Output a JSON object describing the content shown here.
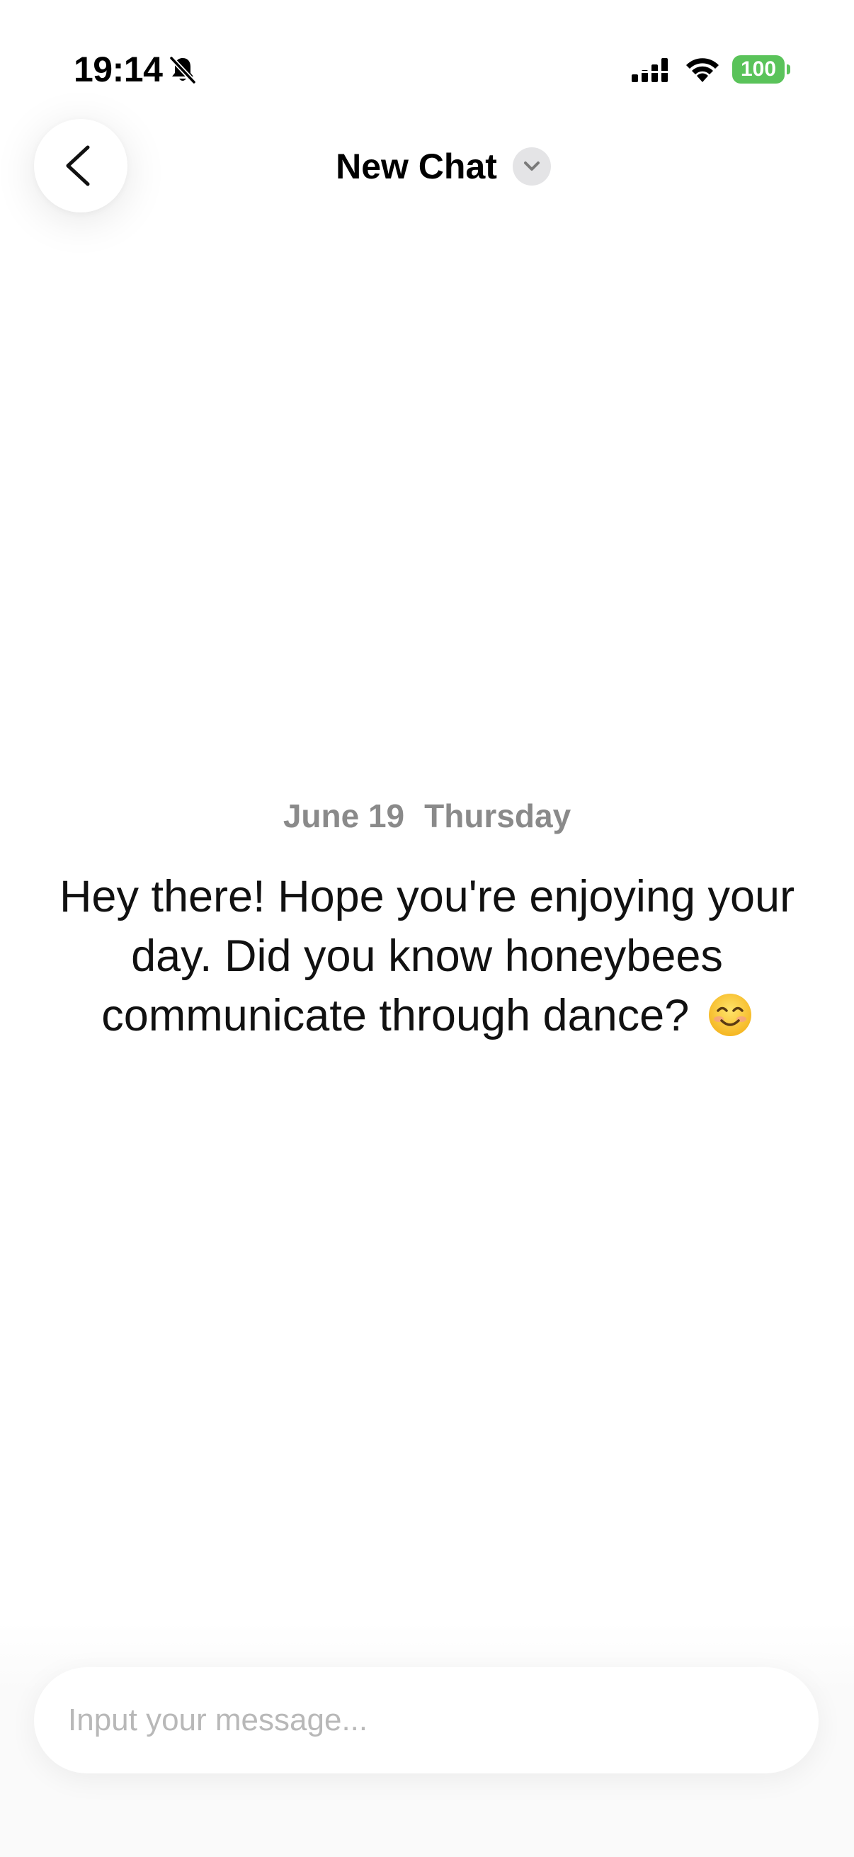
{
  "status_bar": {
    "time": "19:14",
    "silent_icon": "bell-slash-icon",
    "signal_icon": "cellular-signal-icon",
    "wifi_icon": "wifi-icon",
    "battery_level": "100",
    "battery_color": "#5ac35a"
  },
  "header": {
    "back_icon": "chevron-left-icon",
    "title": "New Chat",
    "dropdown_icon": "chevron-down-icon"
  },
  "chat": {
    "date": "June 19",
    "weekday": "Thursday",
    "message": "Hey there! Hope you're enjoying your day. Did you know honeybees communicate through dance?",
    "message_emoji": "😊"
  },
  "composer": {
    "placeholder": "Input your message..."
  }
}
